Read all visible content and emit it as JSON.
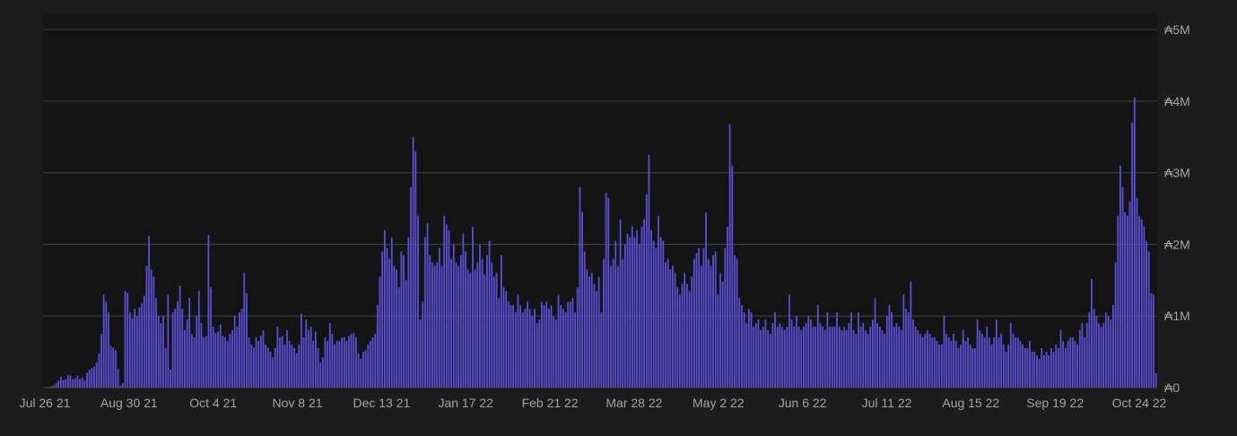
{
  "chart_data": {
    "type": "bar",
    "title": "",
    "xlabel": "",
    "ylabel": "",
    "currency_symbol": "A",
    "ylim": [
      0,
      5000000
    ],
    "y_ticks": [
      {
        "value": 0,
        "label": "₳0"
      },
      {
        "value": 1000000,
        "label": "₳1M"
      },
      {
        "value": 2000000,
        "label": "₳2M"
      },
      {
        "value": 3000000,
        "label": "₳3M"
      },
      {
        "value": 4000000,
        "label": "₳4M"
      },
      {
        "value": 5000000,
        "label": "₳5M"
      }
    ],
    "x_ticks": [
      "Jul 26 21",
      "Aug 30 21",
      "Oct 4 21",
      "Nov 8 21",
      "Dec 13 21",
      "Jan 17 22",
      "Feb 21 22",
      "Mar 28 22",
      "May 2 22",
      "Jun 6 22",
      "Jul 11 22",
      "Aug 15 22",
      "Sep 19 22",
      "Oct 24 22"
    ],
    "x_start": "2021-07-26",
    "bar_color": "#5a4fd6",
    "grid": true,
    "series": [
      {
        "values": [
          0,
          0,
          10000,
          20000,
          30000,
          60000,
          100000,
          150000,
          100000,
          120000,
          180000,
          170000,
          120000,
          130000,
          170000,
          120000,
          140000,
          100000,
          210000,
          250000,
          270000,
          290000,
          350000,
          480000,
          750000,
          1300000,
          1200000,
          1050000,
          580000,
          560000,
          520000,
          260000,
          30000,
          60000,
          1350000,
          1320000,
          1050000,
          970000,
          1100000,
          1000000,
          1120000,
          1180000,
          1280000,
          1700000,
          2120000,
          1650000,
          1550000,
          1250000,
          1000000,
          900000,
          1000000,
          550000,
          1300000,
          250000,
          1050000,
          1100000,
          1200000,
          1420000,
          1100000,
          800000,
          950000,
          1250000,
          750000,
          700000,
          1000000,
          1350000,
          900000,
          700000,
          720000,
          2130000,
          1400000,
          850000,
          760000,
          780000,
          880000,
          720000,
          700000,
          650000,
          750000,
          800000,
          1000000,
          850000,
          1050000,
          1100000,
          1600000,
          1320000,
          700000,
          600000,
          560000,
          700000,
          650000,
          720000,
          800000,
          600000,
          560000,
          500000,
          420000,
          550000,
          850000,
          700000,
          720000,
          600000,
          800000,
          650000,
          600000,
          550000,
          480000,
          600000,
          1030000,
          700000,
          950000,
          800000,
          850000,
          650000,
          780000,
          550000,
          350000,
          420000,
          700000,
          650000,
          900000,
          750000,
          600000,
          650000,
          650000,
          700000,
          700000,
          650000,
          720000,
          750000,
          760000,
          700000,
          480000,
          400000,
          500000,
          520000,
          600000,
          650000,
          700000,
          750000,
          1150000,
          1550000,
          1900000,
          2200000,
          1950000,
          1800000,
          2100000,
          1700000,
          1650000,
          1400000,
          1900000,
          1850000,
          1500000,
          2100000,
          2800000,
          3500000,
          3300000,
          2400000,
          950000,
          1200000,
          2100000,
          2300000,
          1850000,
          1750000,
          1700000,
          1750000,
          1950000,
          1700000,
          2400000,
          2280000,
          2200000,
          1800000,
          2000000,
          1750000,
          1700000,
          1850000,
          2150000,
          1900000,
          1650000,
          1600000,
          2250000,
          1650000,
          1750000,
          2000000,
          1800000,
          1580000,
          1850000,
          2050000,
          1750000,
          1550000,
          1600000,
          1250000,
          1850000,
          1400000,
          1350000,
          1200000,
          1150000,
          1150000,
          1050000,
          1300000,
          1150000,
          1050000,
          1100000,
          1200000,
          1100000,
          1000000,
          1100000,
          900000,
          950000,
          1200000,
          1150000,
          1200000,
          1100000,
          1150000,
          1000000,
          950000,
          1300000,
          1150000,
          1100000,
          1050000,
          1200000,
          1200000,
          1250000,
          1050000,
          1400000,
          2800000,
          2450000,
          1900000,
          1650000,
          1550000,
          1600000,
          1450000,
          1350000,
          1550000,
          1050000,
          1800000,
          2720000,
          2650000,
          1700000,
          1800000,
          2050000,
          1700000,
          2350000,
          1800000,
          2000000,
          2150000,
          2100000,
          2250000,
          2100000,
          2200000,
          2000000,
          2250000,
          2350000,
          2700000,
          3250000,
          2200000,
          2050000,
          1950000,
          2400000,
          2100000,
          2050000,
          1750000,
          1800000,
          1650000,
          1700000,
          1600000,
          1400000,
          1300000,
          1450000,
          1600000,
          1450000,
          1350000,
          1550000,
          1800000,
          1880000,
          1950000,
          1700000,
          1950000,
          2450000,
          1800000,
          1700000,
          1850000,
          1900000,
          1300000,
          1600000,
          1480000,
          1950000,
          2250000,
          3680000,
          3100000,
          1850000,
          1800000,
          1250000,
          1150000,
          1050000,
          900000,
          1100000,
          1050000,
          850000,
          900000,
          950000,
          800000,
          850000,
          950000,
          800000,
          750000,
          900000,
          1050000,
          850000,
          900000,
          850000,
          800000,
          850000,
          1300000,
          950000,
          850000,
          1000000,
          850000,
          800000,
          850000,
          900000,
          1000000,
          950000,
          850000,
          850000,
          1150000,
          900000,
          850000,
          800000,
          1050000,
          850000,
          850000,
          850000,
          1050000,
          850000,
          800000,
          850000,
          800000,
          900000,
          1050000,
          800000,
          750000,
          1050000,
          850000,
          900000,
          800000,
          750000,
          850000,
          950000,
          1250000,
          900000,
          850000,
          800000,
          750000,
          1000000,
          1150000,
          1050000,
          850000,
          900000,
          850000,
          800000,
          1300000,
          1100000,
          1050000,
          1480000,
          950000,
          850000,
          800000,
          750000,
          700000,
          750000,
          800000,
          750000,
          700000,
          700000,
          650000,
          600000,
          600000,
          1000000,
          750000,
          700000,
          650000,
          750000,
          650000,
          550000,
          600000,
          800000,
          650000,
          700000,
          600000,
          550000,
          550000,
          950000,
          800000,
          750000,
          700000,
          850000,
          700000,
          600000,
          700000,
          950000,
          700000,
          750000,
          600000,
          500000,
          600000,
          900000,
          750000,
          700000,
          700000,
          650000,
          600000,
          550000,
          550000,
          650000,
          500000,
          500000,
          450000,
          400000,
          550000,
          450000,
          500000,
          450000,
          550000,
          500000,
          600000,
          550000,
          800000,
          650000,
          550000,
          650000,
          700000,
          700000,
          650000,
          600000,
          800000,
          900000,
          700000,
          900000,
          1050000,
          1520000,
          1100000,
          1000000,
          900000,
          850000,
          900000,
          1050000,
          1000000,
          950000,
          1150000,
          1750000,
          2400000,
          3100000,
          2800000,
          2450000,
          2400000,
          2600000,
          3700000,
          4050000,
          2650000,
          2400000,
          2350000,
          2250000,
          2050000,
          1900000,
          1320000,
          1300000,
          200000
        ]
      }
    ]
  }
}
